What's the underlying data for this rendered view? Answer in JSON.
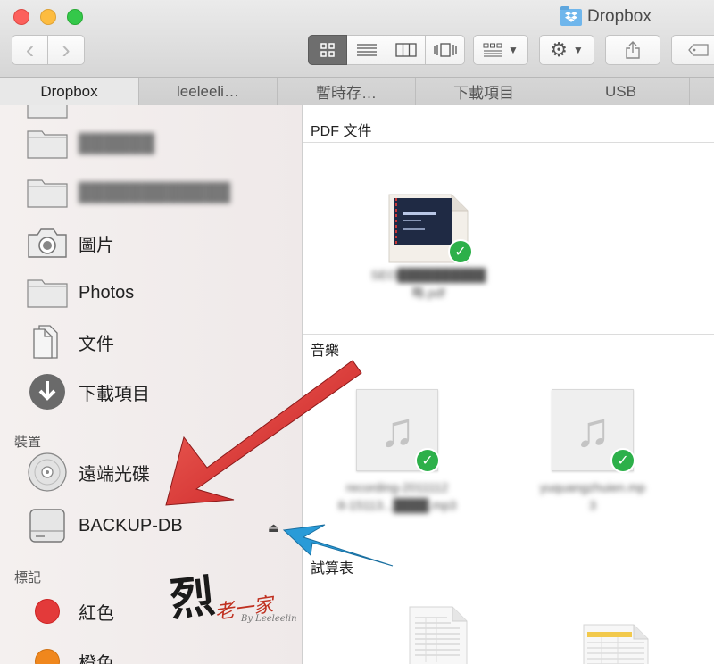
{
  "window": {
    "title": "Dropbox"
  },
  "toolbar": {
    "back_glyph": "‹",
    "forward_glyph": "›",
    "views": [
      "icon-view",
      "list-view",
      "column-view",
      "cover-flow-view"
    ],
    "arrange_icon": "arrange-grid-icon",
    "action_icon": "gear-icon",
    "share_icon": "share-icon",
    "tag_icon": "tag-icon"
  },
  "tabs": [
    {
      "label": "Dropbox",
      "active": true
    },
    {
      "label": "leeleeli…",
      "active": false
    },
    {
      "label": "暫時存…",
      "active": false
    },
    {
      "label": "下載項目",
      "active": false
    },
    {
      "label": "USB",
      "active": false
    }
  ],
  "sidebar": {
    "favorites": [
      {
        "label": "██████",
        "icon": "folder-icon",
        "blurred": true
      },
      {
        "label": "████████████",
        "icon": "folder-icon",
        "blurred": true
      },
      {
        "label": "圖片",
        "icon": "camera-icon",
        "blurred": false
      },
      {
        "label": "Photos",
        "icon": "folder-icon",
        "blurred": false
      },
      {
        "label": "文件",
        "icon": "document-icon",
        "blurred": false
      },
      {
        "label": "下載項目",
        "icon": "download-icon",
        "blurred": false
      }
    ],
    "devices_header": "裝置",
    "devices": [
      {
        "label": "遠端光碟",
        "icon": "disc-icon"
      },
      {
        "label": "BACKUP-DB",
        "icon": "drive-icon",
        "eject": true
      }
    ],
    "tags_header": "標記",
    "tags": [
      {
        "label": "紅色",
        "color": "#e33a3a"
      },
      {
        "label": "橙色",
        "color": "#f0871d"
      }
    ]
  },
  "main": {
    "groups": [
      {
        "header": "PDF 文件",
        "files": [
          {
            "caption_line1": "SEO██████████",
            "caption_line2": "略.pdf",
            "synced": true
          }
        ]
      },
      {
        "header": "音樂",
        "files": [
          {
            "caption_line1": "recording-2011112",
            "caption_line2": "8-15113...████.mp3",
            "synced": true
          },
          {
            "caption_line1": "yuquangzhuien.mp",
            "caption_line2": "3",
            "synced": true
          }
        ]
      },
      {
        "header": "試算表",
        "files": []
      }
    ]
  },
  "watermark": {
    "sign": "烈",
    "text": "老一家",
    "by": "By Leeleelin"
  },
  "colors": {
    "accent_red_arrow": "#e23a3a",
    "accent_blue_arrow": "#2a9bd8",
    "sync_green": "#2db04a"
  }
}
